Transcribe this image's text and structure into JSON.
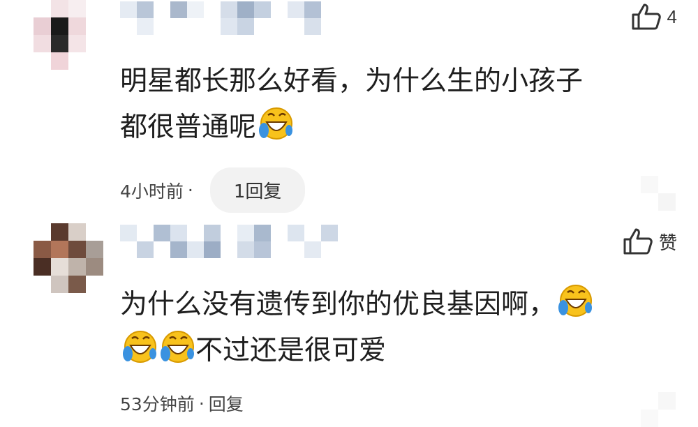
{
  "comments": [
    {
      "like_count": "4",
      "text_line1": "明星都长那么好看，为什么生的小孩子",
      "text_line2": "都很普通呢",
      "time": "4小时前",
      "separator": "·",
      "reply_button": "1回复"
    },
    {
      "like_count": "赞",
      "text_line1": "为什么没有遗传到你的优良基因啊，",
      "text_line2": "不过还是很可爱",
      "time": "53分钟前",
      "separator": "·",
      "reply_button": "回复"
    }
  ],
  "icons": {
    "like": "thumbs-up-outline-icon",
    "emoji": "rolling-on-floor-laughing-emoji-icon"
  },
  "colors": {
    "background": "#ffffff",
    "text": "#1e1e1e",
    "meta": "#444444",
    "reply_pill_bg": "#f2f2f2",
    "emoji_yellow": "#f8c21c",
    "emoji_tear": "#3a92e0"
  }
}
